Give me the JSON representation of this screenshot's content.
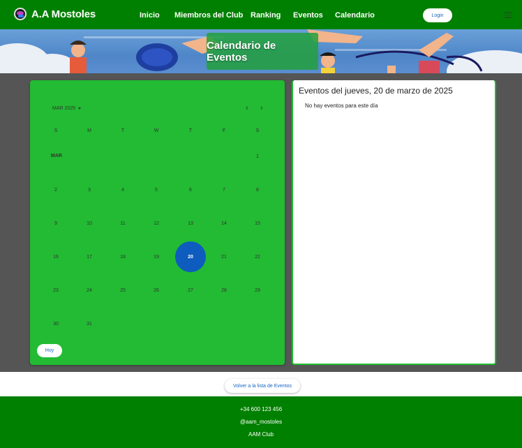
{
  "navbar": {
    "brand": "A.A Mostoles",
    "links": [
      "Inicio",
      "Miembros del Club",
      "Ranking",
      "Eventos",
      "Calendario"
    ],
    "login_label": "Login",
    "bg_color": "#008000"
  },
  "banner": {
    "title": "Calendario de Eventos"
  },
  "calendar": {
    "month_year": "MAR 2025",
    "prev_icon": "‹",
    "next_icon": "›",
    "weekdays": [
      "S",
      "M",
      "T",
      "W",
      "T",
      "F",
      "S"
    ],
    "month_label": "MAR",
    "days": [
      "1",
      "2",
      "3",
      "4",
      "5",
      "6",
      "7",
      "8",
      "9",
      "10",
      "11",
      "12",
      "13",
      "14",
      "15",
      "16",
      "17",
      "18",
      "19",
      "20",
      "21",
      "22",
      "23",
      "24",
      "25",
      "26",
      "27",
      "28",
      "29",
      "30",
      "31"
    ],
    "selected_day": "20",
    "today_label": "Hoy",
    "bg_color": "#22bb33",
    "selected_color": "#0d5cbe"
  },
  "events": {
    "title": "Eventos del jueves, 20 de marzo de 2025",
    "empty_message": "No hay eventos para este día"
  },
  "back_button": "Volver a la lista de Eventos",
  "footer": {
    "phone": "+34 600 123 456",
    "social": "@aam_mostoles",
    "club": "AAM Club"
  }
}
